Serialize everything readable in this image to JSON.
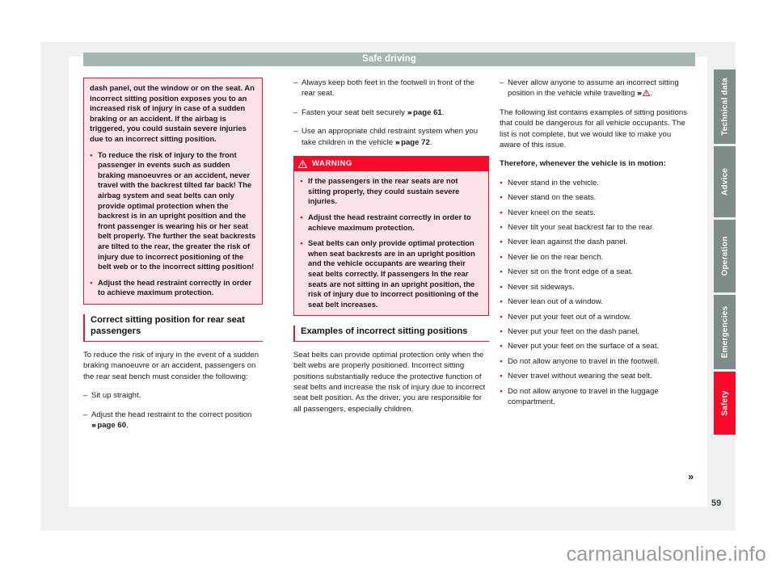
{
  "document": {
    "header_title": "Safe driving",
    "page_number": "59",
    "watermark": "carmanualsonline.info"
  },
  "colors": {
    "accent_red": "#e8142d",
    "warning_red": "#fa0a28",
    "pink_fill": "#fbe2e6",
    "header_gray": "#a7b4b4",
    "tab_gray": "#808c8c",
    "page_frame": "#eef1f2"
  },
  "column1": {
    "note_box": {
      "paragraphs": [
        "dash panel, out the window or on the seat. An incorrect sitting position exposes you to an increased risk of injury in case of a sudden braking or an accident. If the airbag is triggered, you could sustain severe injuries due to an incorrect sitting position."
      ],
      "bullets": [
        "To reduce the risk of injury to the front passenger in events such as sudden braking manoeuvres or an accident, never travel with the backrest tilted far back! The airbag system and seat belts can only provide optimal protection when the backrest is in an upright position and the front passenger is wearing his or her seat belt properly. The further the seat backrests are tilted to the rear, the greater the risk of injury due to incorrect positioning of the belt web or to the incorrect sitting position!",
        "Adjust the head restraint correctly in order to achieve maximum protection."
      ]
    },
    "section": {
      "heading": "Correct sitting position for rear seat passengers",
      "intro": "To reduce the risk of injury in the event of a sudden braking manoeuvre or an accident, passengers on the rear seat bench must consider the following:",
      "items": [
        {
          "text": "Sit up straight.",
          "ref": ""
        },
        {
          "text": "Adjust the head restraint to the correct position",
          "ref": "page 60",
          "ref_arrows": "›››",
          "suffix": "."
        }
      ]
    }
  },
  "column2": {
    "items": [
      {
        "text": "Always keep both feet in the footwell in front of the rear seat.",
        "ref": "",
        "suffix": ""
      },
      {
        "text": "Fasten your seat belt securely",
        "ref": "page 61",
        "ref_arrows": "›››",
        "suffix": "."
      },
      {
        "text": "Use an appropriate child restraint system when you take children in the vehicle",
        "ref": "page 72",
        "ref_arrows": "›››",
        "suffix": "."
      }
    ],
    "warning": {
      "label": "WARNING",
      "icon": "warning-triangle-icon",
      "bullets": [
        "If the passengers in the rear seats are not sitting properly, they could sustain severe injuries.",
        "Adjust the head restraint correctly in order to achieve maximum protection.",
        "Seat belts can only provide optimal protection when seat backrests are in an upright position and the vehicle occupants are wearing their seat belts correctly. If passengers In the rear seats are not sitting in an upright position, the risk of injury due to incorrect positioning of the seat belt increases."
      ]
    },
    "section": {
      "heading": "Examples of incorrect sitting positions",
      "body": "Seat belts can provide optimal protection only when the belt webs are properly positioned. Incorrect sitting positions substantially reduce the protective function of seat belts and increase the risk of injury due to incorrect seat belt position. As the driver, you are responsible for all passengers, especially children."
    }
  },
  "column3": {
    "lead_item": {
      "text": "Never allow anyone to assume an incorrect sitting position in the vehicle while travelling",
      "ref_arrows": "›››",
      "ref_icon": "warning-triangle-icon",
      "suffix": "."
    },
    "intro": "The following list contains examples of sitting positions that could be dangerous for all vehicle occupants. The list is not complete, but we would like to make you aware of this issue.",
    "lead_bold": "Therefore, whenever the vehicle is in motion:",
    "bullets": [
      "Never stand in the vehicle.",
      "Never stand on the seats.",
      "Never kneel on the seats.",
      "Never tilt your seat backrest far to the rear.",
      "Never lean against the dash panel.",
      "Never lie on the rear bench.",
      "Never sit on the front edge of a seat.",
      "Never sit sideways.",
      "Never lean out of a window.",
      "Never put your feet out of a window.",
      "Never put your feet on the dash panel.",
      "Never put your feet on the surface of a seat.",
      "Do not allow anyone to travel in the footwell.",
      "Never travel without wearing the seat belt.",
      "Do not allow anyone to travel in the luggage compartment."
    ],
    "continuation_marker": "»"
  },
  "side_tabs": [
    {
      "label": "Technical data",
      "active": false
    },
    {
      "label": "Advice",
      "active": false
    },
    {
      "label": "Operation",
      "active": false
    },
    {
      "label": "Emergencies",
      "active": false
    },
    {
      "label": "Safety",
      "active": true
    }
  ]
}
